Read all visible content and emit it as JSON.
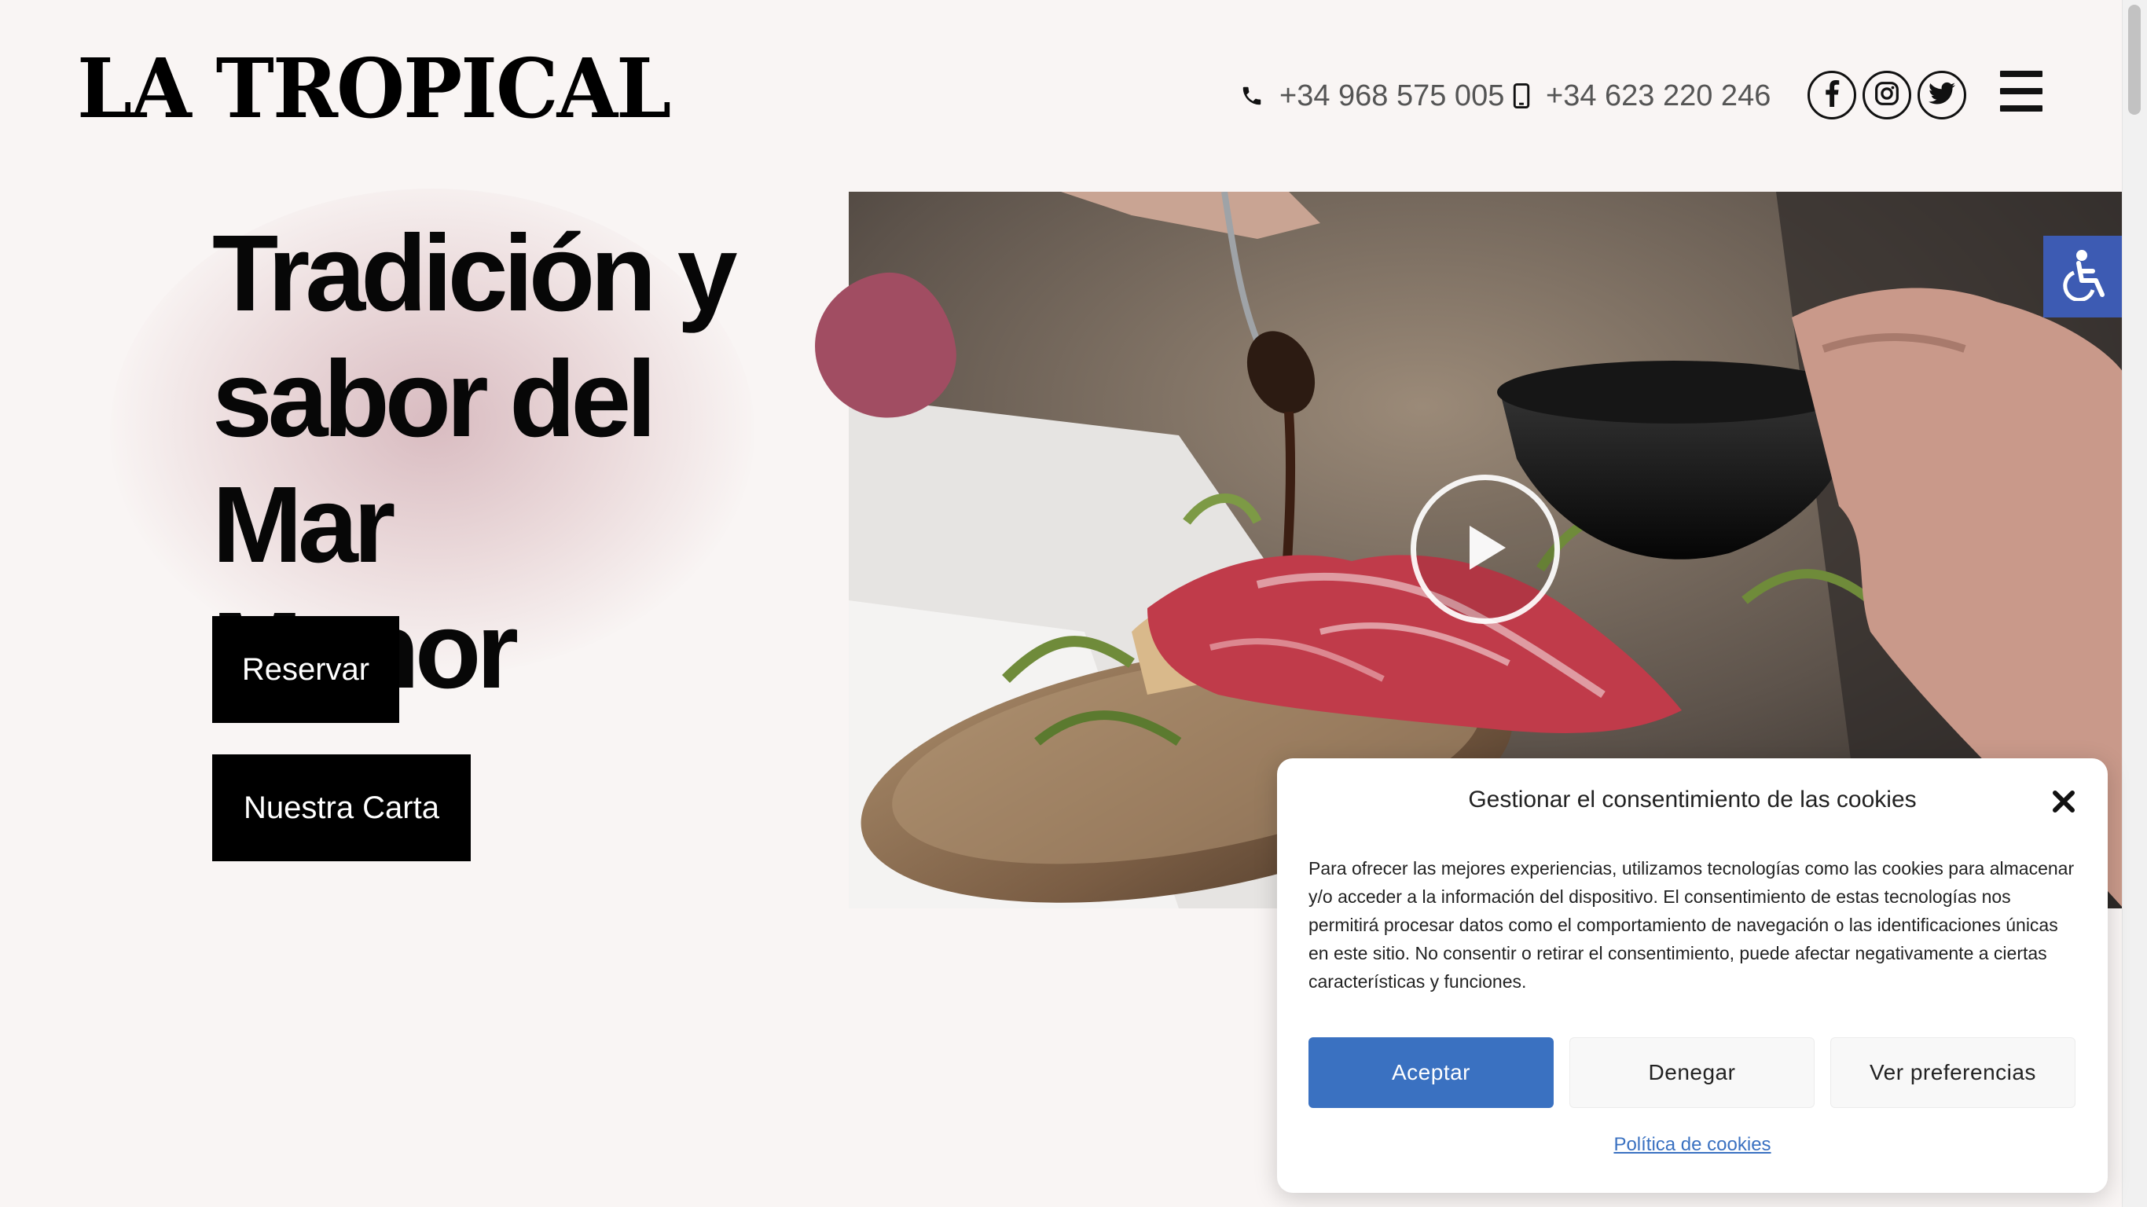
{
  "header": {
    "logo_text": "LA TROPICAL",
    "phone_landline": "+34 968 575 005",
    "phone_mobile": "+34 623 220 246",
    "social": [
      "facebook-icon",
      "instagram-icon",
      "twitter-icon"
    ],
    "menu_icon": "hamburger-icon"
  },
  "hero": {
    "headline_line1": "Tradición y",
    "headline_line2": "sabor del Mar",
    "headline_line3": "Menor",
    "reserve_label": "Reservar",
    "menu_label": "Nuestra Carta",
    "video_play_icon": "play-icon"
  },
  "accessibility": {
    "icon": "wheelchair-icon"
  },
  "cookie_modal": {
    "title": "Gestionar el consentimiento de las cookies",
    "body": "Para ofrecer las mejores experiencias, utilizamos tecnologías como las cookies para almacenar y/o acceder a la información del dispositivo. El consentimiento de estas tecnologías nos permitirá procesar datos como el comportamiento de navegación o las identificaciones únicas en este sitio. No consentir o retirar el consentimiento, puede afectar negativamente a ciertas características y funciones.",
    "accept_label": "Aceptar",
    "deny_label": "Denegar",
    "preferences_label": "Ver preferencias",
    "policy_link": "Política de cookies"
  },
  "colors": {
    "background": "#f9f5f4",
    "accent_blob": "#a14d62",
    "primary_button": "#3a71c1",
    "accessibility_button": "#3d5bb3"
  }
}
